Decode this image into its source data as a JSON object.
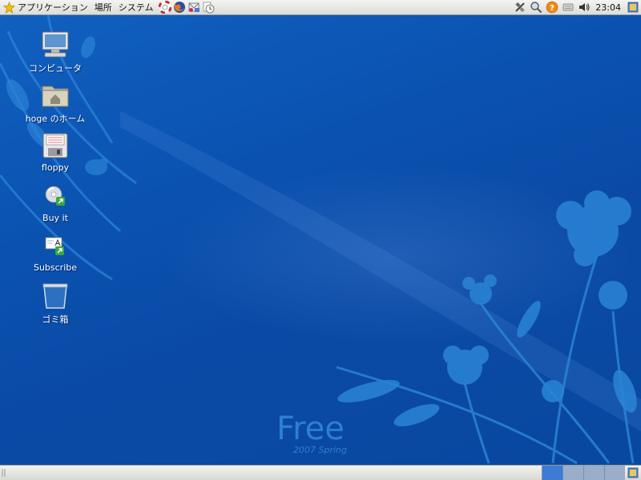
{
  "top_panel": {
    "menus": {
      "applications": "アプリケーション",
      "places": "場所",
      "system": "システム"
    },
    "launchers": [
      "help-lifebuoy-icon",
      "firefox-icon",
      "mail-client-icon",
      "clock-notes-icon"
    ],
    "tray": [
      "network-icon",
      "search-icon",
      "help-icon",
      "keyboard-icon",
      "volume-icon"
    ],
    "clock": "23:04"
  },
  "desktop": {
    "wallpaper_text": {
      "title": "Free",
      "subtitle": "2007 Spring"
    },
    "icons": [
      {
        "label": "コンピュータ",
        "icon": "computer-icon"
      },
      {
        "label": "hoge のホーム",
        "icon": "home-folder-icon"
      },
      {
        "label": "floppy",
        "icon": "floppy-icon"
      },
      {
        "label": "Buy it",
        "icon": "cd-buy-icon"
      },
      {
        "label": "Subscribe",
        "icon": "subscribe-icon"
      },
      {
        "label": "ゴミ箱",
        "icon": "trash-icon"
      }
    ]
  },
  "bottom_panel": {
    "workspaces": [
      "workspace-1",
      "workspace-2",
      "workspace-3",
      "workspace-4"
    ],
    "active_workspace": 1
  },
  "colors": {
    "desktop_bg": "#0a4aa0",
    "flower": "#2a84d6",
    "active_workspace": "#3d7bd4"
  }
}
